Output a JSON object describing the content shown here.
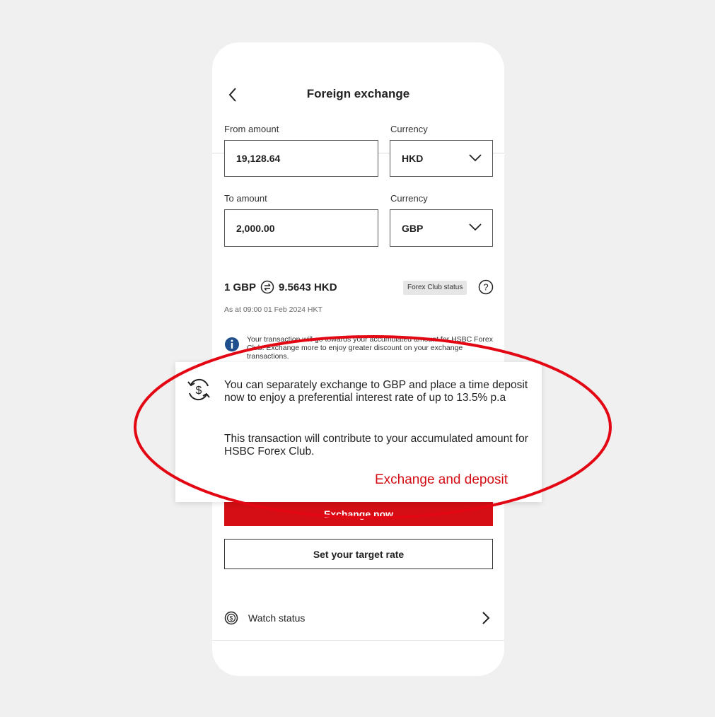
{
  "header": {
    "title": "Foreign exchange"
  },
  "form": {
    "from_label": "From amount",
    "from_value": "19,128.64",
    "from_currency_label": "Currency",
    "from_currency": "HKD",
    "to_label": "To amount",
    "to_value": "2,000.00",
    "to_currency_label": "Currency",
    "to_currency": "GBP"
  },
  "rate": {
    "left": "1 GBP",
    "right": "9.5643 HKD",
    "as_at": "As at 09:00 01 Feb 2024 HKT",
    "club_badge": "Forex Club status"
  },
  "info": {
    "text": "Your transaction will go towards your accumulated amount for HSBC Forex Club. Exchange more to enjoy greater discount on your exchange transactions."
  },
  "popup": {
    "text1": "You can separately exchange to GBP and place a time deposit now to enjoy a preferential interest rate of up to 13.5% p.a",
    "text2": "This transaction will contribute to your accumulated amount for HSBC Forex Club.",
    "link": "Exchange and deposit"
  },
  "actions": {
    "exchange_now": "Exchange now",
    "set_target": "Set your target rate"
  },
  "watch": {
    "label": "Watch status"
  },
  "colors": {
    "brand_red": "#d40e14",
    "info_blue": "#1f4e8c"
  }
}
